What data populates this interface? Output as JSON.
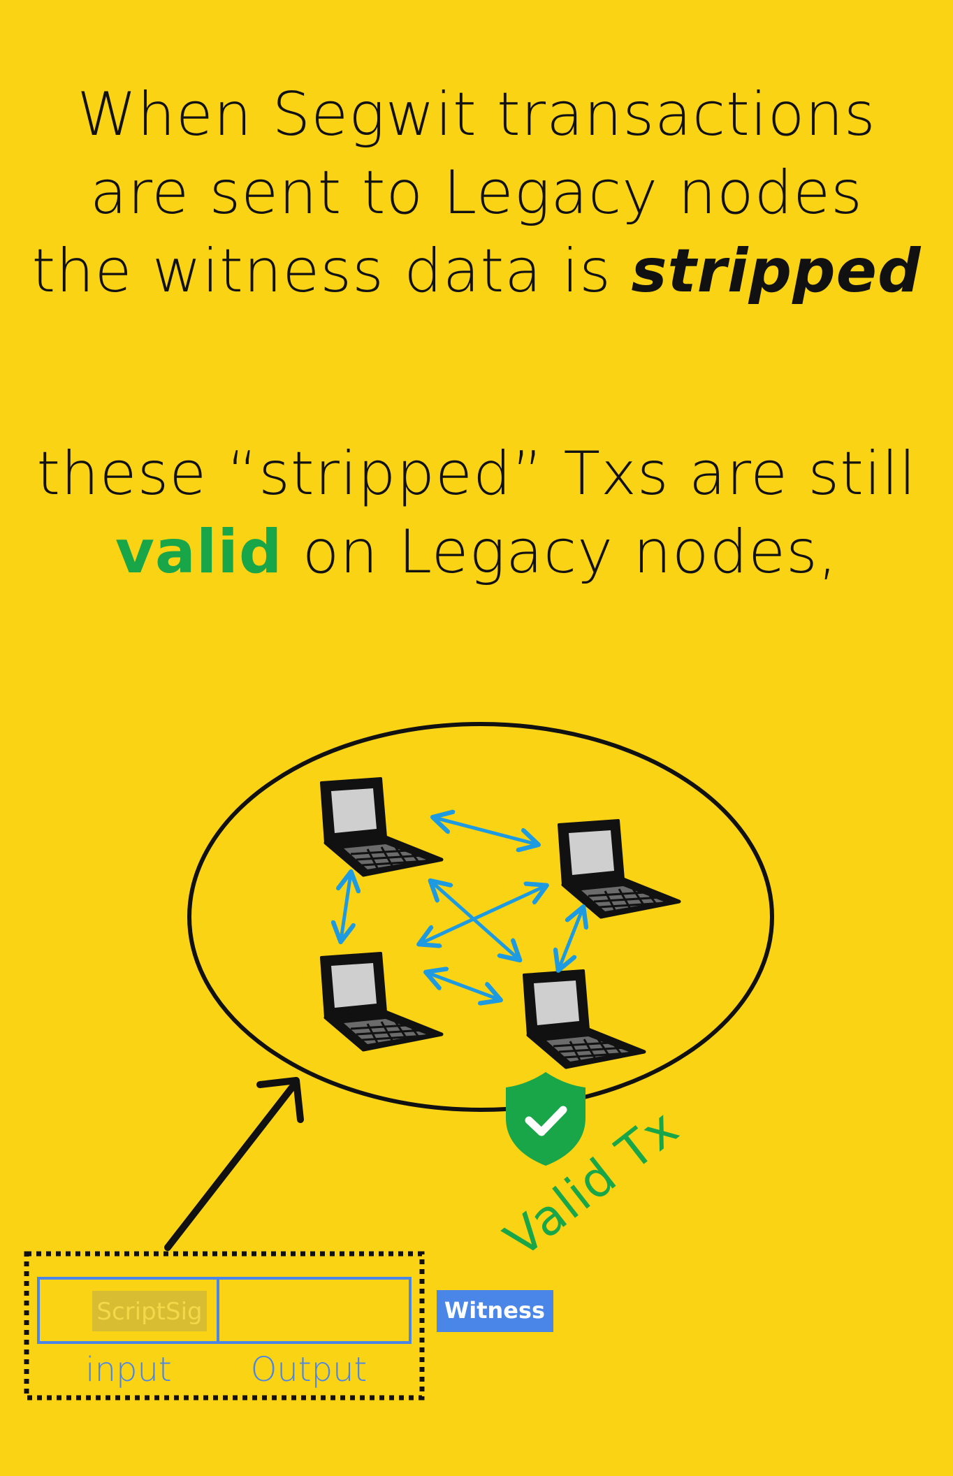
{
  "headline_top": {
    "line1": "When Segwit transactions",
    "line2": "are sent to Legacy nodes",
    "line3_prefix": "the witness data is ",
    "line3_emphasis": "stripped"
  },
  "headline_bottom": {
    "line1": "these “stripped” Txs are still",
    "line2_emphasis": "valid",
    "line2_suffix": " on Legacy nodes,"
  },
  "network": {
    "node_icon": "laptop-icon",
    "link_icon": "double-arrow-icon",
    "badge_icon": "shield-check-icon",
    "badge_label": "Valid Tx"
  },
  "transaction": {
    "scriptsig_label": "ScriptSig",
    "input_label": "input",
    "output_label": "Output",
    "witness_label": "Witness"
  },
  "colors": {
    "background": "#fad314",
    "ink": "#111111",
    "arrow_blue": "#1e9be0",
    "valid_green": "#18a649",
    "tx_blue": "#4a86e8"
  }
}
